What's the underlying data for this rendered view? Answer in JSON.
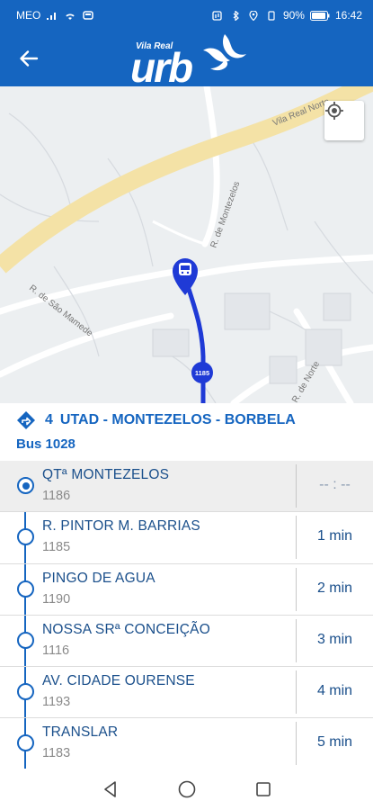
{
  "status_bar": {
    "carrier": "MEO",
    "battery": "90%",
    "time": "16:42"
  },
  "app_bar": {
    "logo_small": "Vila Real",
    "logo_big": "urb"
  },
  "map": {
    "road_labels": [
      "Vila Real Norte",
      "R. de Montezelos",
      "R. de São Mamede",
      "R. de Norte"
    ],
    "stop_marker": "1185"
  },
  "line": {
    "number": "4",
    "name": "UTAD - MONTEZELOS - BORBELA",
    "bus": "Bus 1028"
  },
  "stops": [
    {
      "name": "QTª MONTEZELOS",
      "code": "1186",
      "eta": "-- : --",
      "current": true
    },
    {
      "name": "R. PINTOR M. BARRIAS",
      "code": "1185",
      "eta": "1 min",
      "current": false
    },
    {
      "name": "PINGO DE AGUA",
      "code": "1190",
      "eta": "2 min",
      "current": false
    },
    {
      "name": "NOSSA SRª CONCEIÇÃO",
      "code": "1116",
      "eta": "3 min",
      "current": false
    },
    {
      "name": "AV. CIDADE OURENSE",
      "code": "1193",
      "eta": "4 min",
      "current": false
    },
    {
      "name": "TRANSLAR",
      "code": "1183",
      "eta": "5 min",
      "current": false
    }
  ],
  "colors": {
    "primary": "#1565c0",
    "route": "#1f3ad6",
    "highway": "#f4e2a6"
  }
}
